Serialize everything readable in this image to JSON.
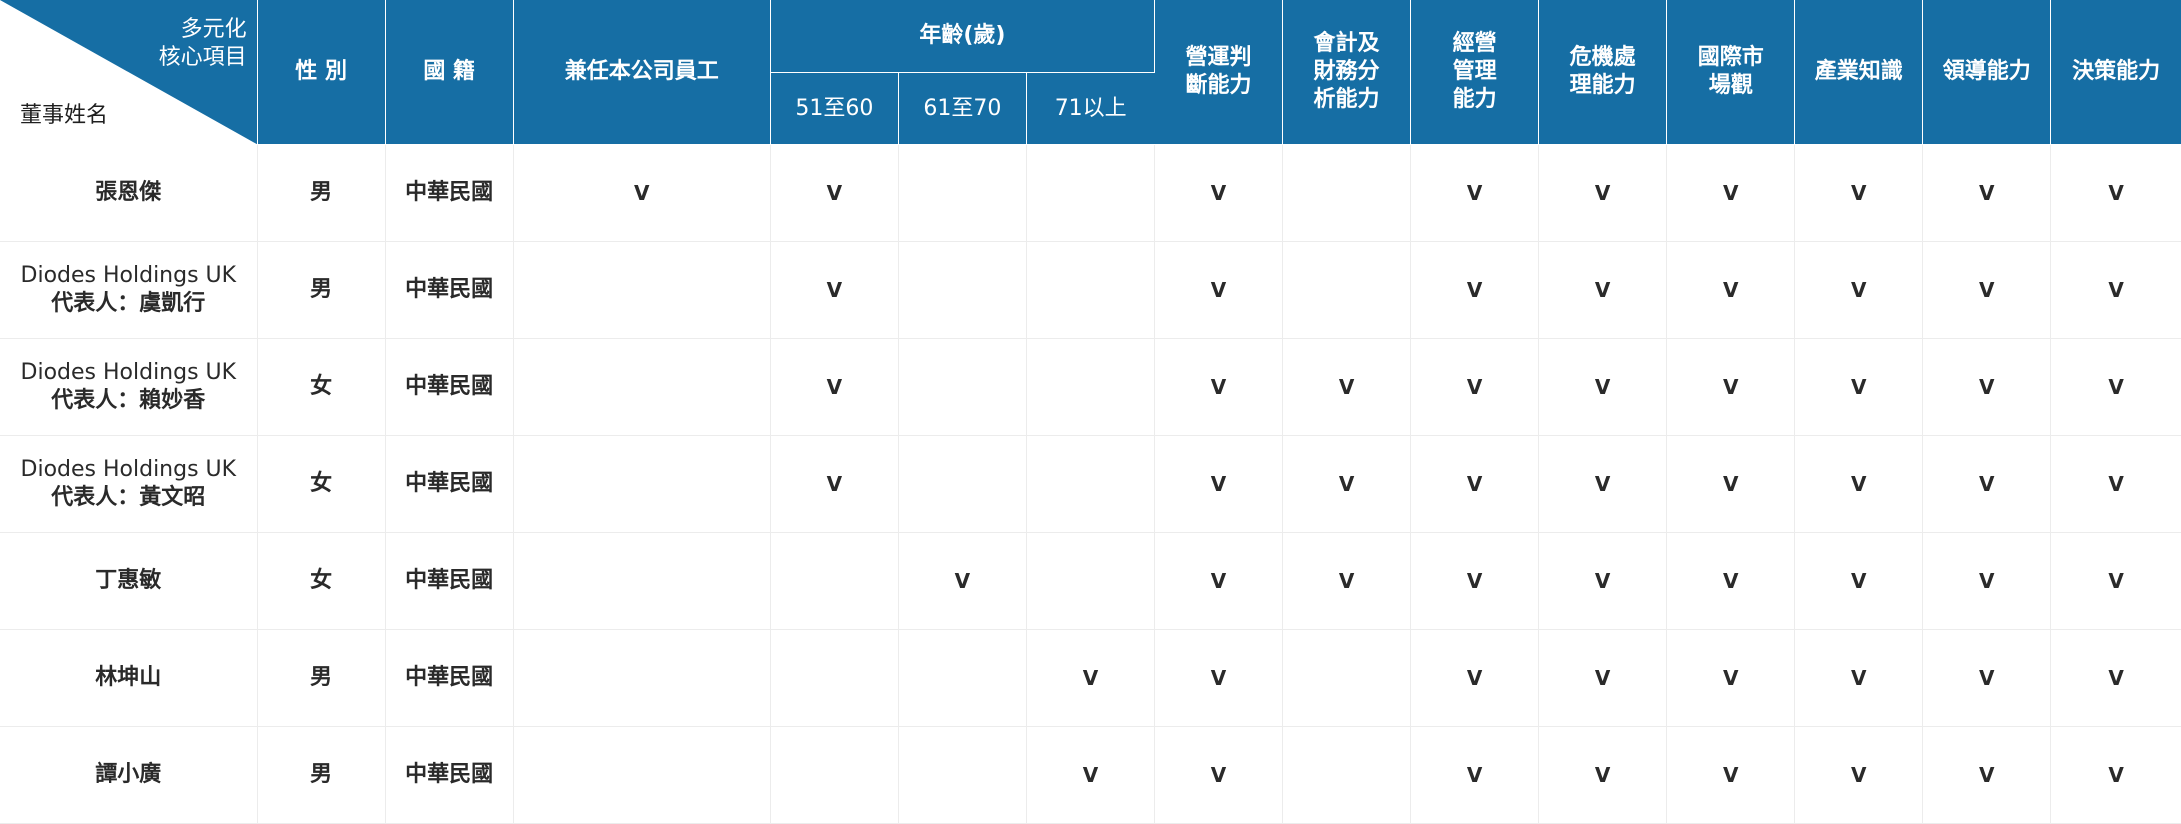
{
  "header": {
    "corner_top": "多元化\n核心項目",
    "corner_bottom": "董事姓名",
    "gender": "性 別",
    "nationality": "國 籍",
    "employee": "兼任本公司員工",
    "age_group": "年齡(歲)",
    "age_51_60": "51至60",
    "age_61_70": "61至70",
    "age_71_up": "71以上",
    "skills": [
      "營運判\n斷能力",
      "會計及\n財務分\n析能力",
      "經營\n管理\n能力",
      "危機處\n理能力",
      "國際市\n場觀",
      "產業知識",
      "領導能力",
      "決策能力"
    ]
  },
  "colors": {
    "header_bg": "#166ea4",
    "header_text": "#ffffff",
    "grid_line": "#ececec"
  },
  "mark_symbol": "V",
  "rows": [
    {
      "name_en": "",
      "name_zh": "張恩傑",
      "gender": "男",
      "nationality": "中華民國",
      "marks": [
        "V",
        "V",
        "",
        "",
        "V",
        "",
        "V",
        "V",
        "V",
        "V",
        "V",
        "V"
      ]
    },
    {
      "name_en": "Diodes Holdings  UK",
      "name_zh": "代表人：虞凱行",
      "gender": "男",
      "nationality": "中華民國",
      "marks": [
        "",
        "V",
        "",
        "",
        "V",
        "",
        "V",
        "V",
        "V",
        "V",
        "V",
        "V"
      ]
    },
    {
      "name_en": "Diodes Holdings  UK",
      "name_zh": "代表人：賴妙香",
      "gender": "女",
      "nationality": "中華民國",
      "marks": [
        "",
        "V",
        "",
        "",
        "V",
        "V",
        "V",
        "V",
        "V",
        "V",
        "V",
        "V"
      ]
    },
    {
      "name_en": "Diodes Holdings  UK",
      "name_zh": "代表人：黃文昭",
      "gender": "女",
      "nationality": "中華民國",
      "marks": [
        "",
        "V",
        "",
        "",
        "V",
        "V",
        "V",
        "V",
        "V",
        "V",
        "V",
        "V"
      ]
    },
    {
      "name_en": "",
      "name_zh": "丁惠敏",
      "gender": "女",
      "nationality": "中華民國",
      "marks": [
        "",
        "",
        "V",
        "",
        "V",
        "V",
        "V",
        "V",
        "V",
        "V",
        "V",
        "V"
      ]
    },
    {
      "name_en": "",
      "name_zh": "林坤山",
      "gender": "男",
      "nationality": "中華民國",
      "marks": [
        "",
        "",
        "",
        "V",
        "V",
        "",
        "V",
        "V",
        "V",
        "V",
        "V",
        "V"
      ]
    },
    {
      "name_en": "",
      "name_zh": "譚小廣",
      "gender": "男",
      "nationality": "中華民國",
      "marks": [
        "",
        "",
        "",
        "V",
        "V",
        "",
        "V",
        "V",
        "V",
        "V",
        "V",
        "V"
      ]
    }
  ]
}
